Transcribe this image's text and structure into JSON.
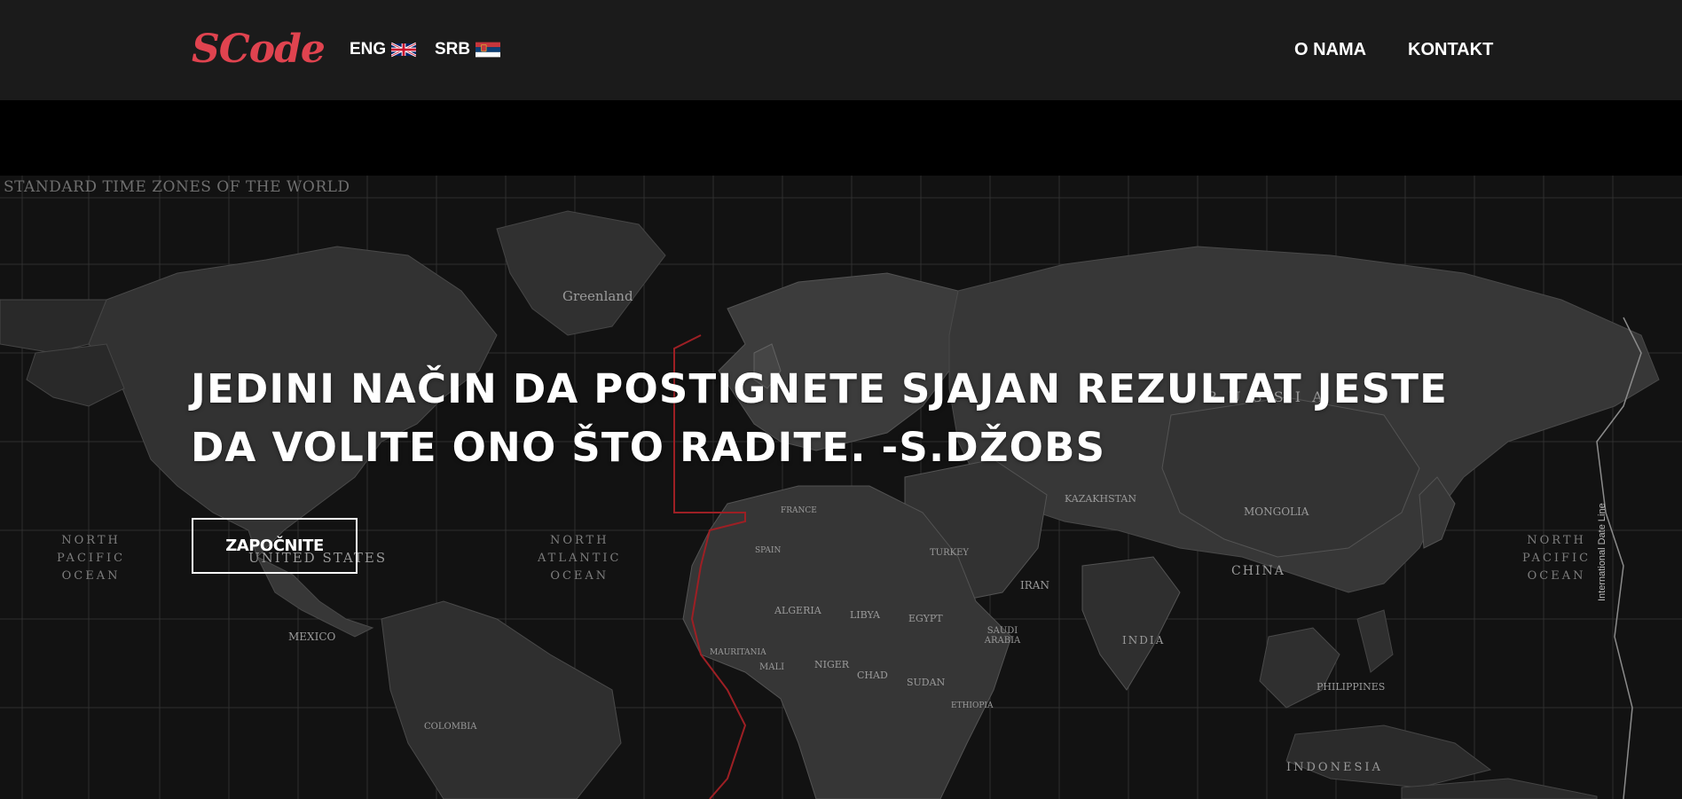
{
  "brand": {
    "logo_text": "SCode",
    "accent_color": "#e0434f"
  },
  "nav": {
    "languages": [
      {
        "label": "ENG",
        "flag": "uk-flag-icon"
      },
      {
        "label": "SRB",
        "flag": "serbia-flag-icon"
      }
    ],
    "links": [
      {
        "label": "O NAMA"
      },
      {
        "label": "KONTAKT"
      }
    ]
  },
  "hero": {
    "quote": "JEDINI NAČIN DA POSTIGNETE SJAJAN REZULTAT JESTE DA VOLITE ONO ŠTO RADITE. -S.DŽOBS",
    "cta_label": "ZAPOČNITE",
    "map": {
      "title": "STANDARD TIME ZONES OF THE WORLD",
      "oceans": [
        {
          "name": "north-atlantic",
          "text": "NORTH\nATLANTIC\nOCEAN"
        },
        {
          "name": "north-pacific-east",
          "text": "NORTH\nPACIFIC\nOCEAN"
        },
        {
          "name": "north-pacific-west",
          "text": "NORTH\nPACIFIC\nOCEAN"
        }
      ],
      "labels": [
        {
          "text": "Greenland"
        },
        {
          "text": "UNITED STATES"
        },
        {
          "text": "MEXICO"
        },
        {
          "text": "CHINA"
        },
        {
          "text": "MONGOLIA"
        },
        {
          "text": "KAZAKHSTAN"
        },
        {
          "text": "INDIA"
        },
        {
          "text": "IRAN"
        },
        {
          "text": "SAUDI ARABIA"
        },
        {
          "text": "ALGERIA"
        },
        {
          "text": "LIBYA"
        },
        {
          "text": "EGYPT"
        },
        {
          "text": "SUDAN"
        },
        {
          "text": "NIGER"
        },
        {
          "text": "CHAD"
        },
        {
          "text": "MALI"
        },
        {
          "text": "MAURITANIA"
        },
        {
          "text": "ETHIOPIA"
        },
        {
          "text": "INDONESIA"
        },
        {
          "text": "PHILIPPINES"
        },
        {
          "text": "TURKEY"
        },
        {
          "text": "SPAIN"
        },
        {
          "text": "FRANCE"
        },
        {
          "text": "COLOMBIA"
        },
        {
          "text": "R U S S I A"
        }
      ],
      "date_line_label": "International Date Line"
    }
  }
}
